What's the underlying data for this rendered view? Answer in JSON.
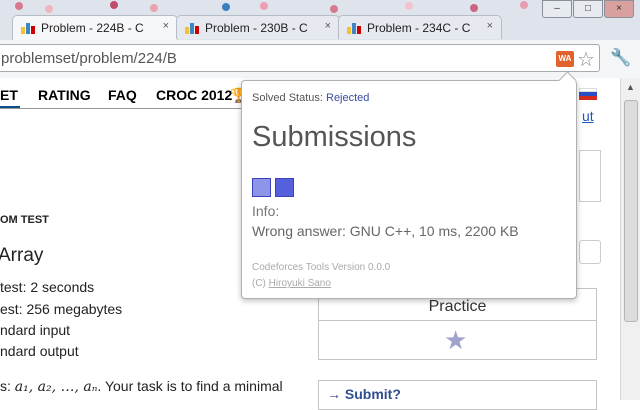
{
  "browser": {
    "tabs": [
      {
        "title": "Problem - 224B - C",
        "active": true
      },
      {
        "title": "Problem - 230B - C",
        "active": false
      },
      {
        "title": "Problem - 234C - C",
        "active": false
      }
    ],
    "tab_close_glyph": "×",
    "url": "problemset/problem/224/B",
    "extension_badge": "WA",
    "bookmark_icon": "star-icon",
    "menu_icon": "wrench-icon",
    "window_controls": [
      "–",
      "□",
      "×"
    ]
  },
  "nav": {
    "items": [
      "ET",
      "RATING",
      "FAQ",
      "CROC 2012"
    ],
    "trophy_icon": "trophy-icon"
  },
  "problem": {
    "label": "OM TEST",
    "title": "Array",
    "properties": [
      "test: 2 seconds",
      "est: 256 megabytes",
      "ndard input",
      "ndard output"
    ],
    "statement_prefix": "s: ",
    "statement_math": "a₁, a₂, …, aₙ",
    "statement_suffix": ". Your task is to find a minimal"
  },
  "sidebar": {
    "link_text": "ut",
    "practice_title": "Practice",
    "submit_link": "→ Submit?"
  },
  "popup": {
    "status_label": "Solved Status:",
    "status_value": "Rejected",
    "heading": "Submissions",
    "info_label": "Info:",
    "verdict": "Wrong answer: GNU C++, 10 ms, 2200 KB",
    "version": "Codeforces Tools Version 0.0.0",
    "credit_prefix": "(C)",
    "credit_author": "Hiroyuki Sano"
  },
  "colors": {
    "chrome_bg": "#dfe4ec",
    "status_rejected": "#3a4aa8",
    "submission_1": "#8e95e8",
    "submission_2": "#5560dc",
    "badge_bg": "#e0632d"
  }
}
